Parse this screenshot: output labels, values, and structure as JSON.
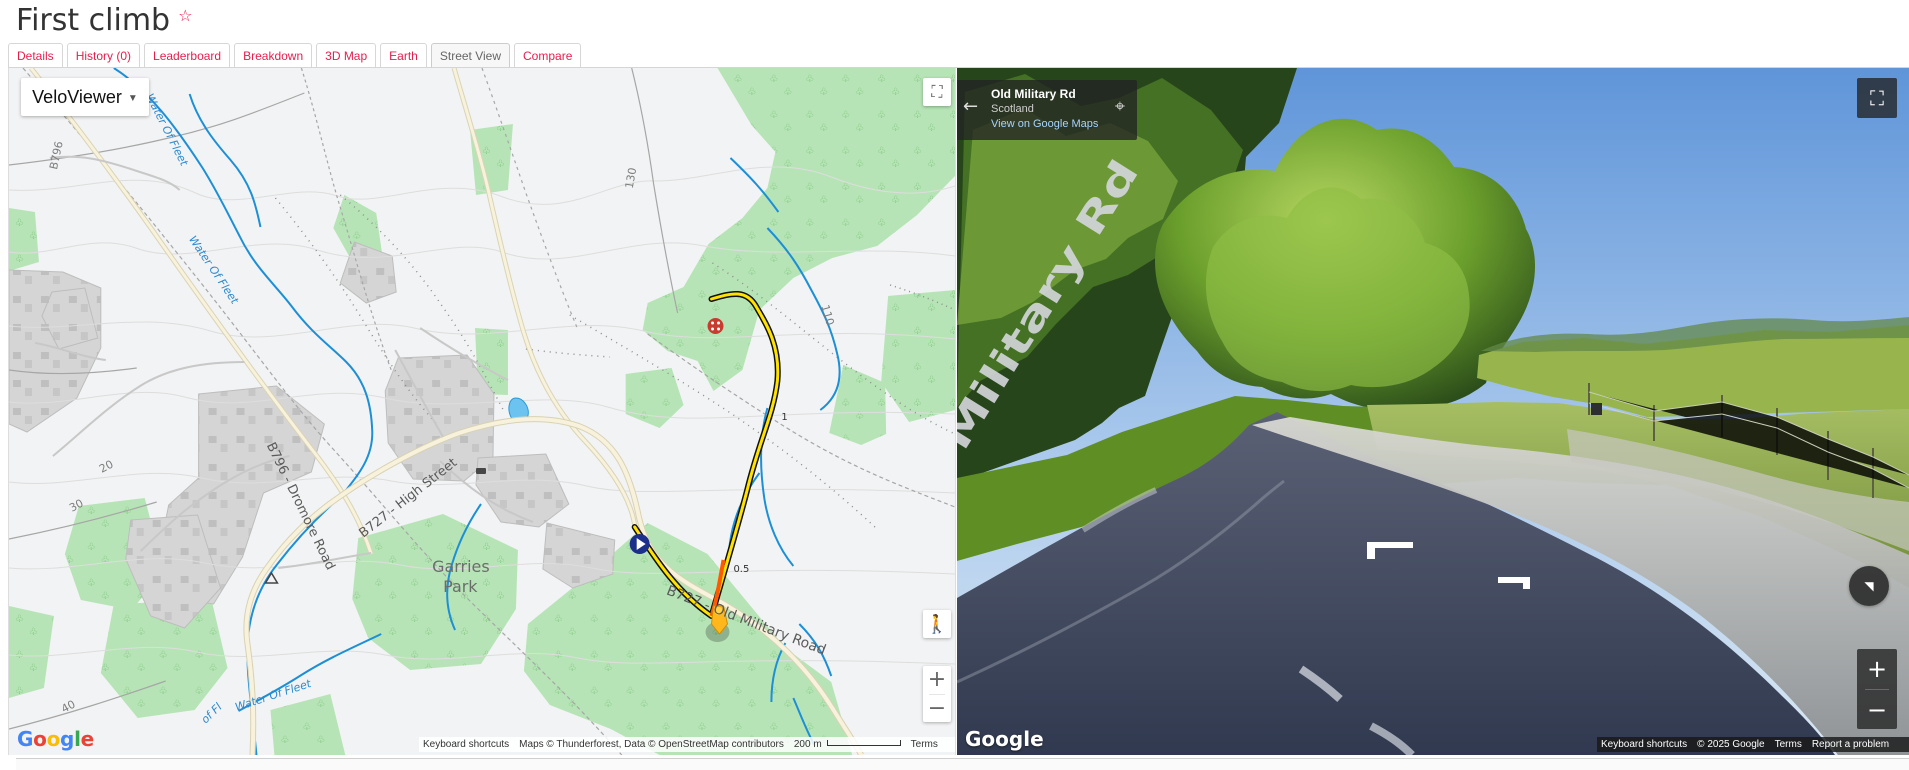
{
  "page": {
    "title": "First climb",
    "title_icon": "star-icon"
  },
  "tabs": [
    {
      "label": "Details"
    },
    {
      "label": "History (0)"
    },
    {
      "label": "Leaderboard"
    },
    {
      "label": "Breakdown"
    },
    {
      "label": "3D Map"
    },
    {
      "label": "Earth"
    },
    {
      "label": "Street View",
      "active": true
    },
    {
      "label": "Compare"
    }
  ],
  "map": {
    "layer_button_label": "VeloViewer",
    "layer_button_icon": "dropdown-caret-icon",
    "fullscreen_icon": "fullscreen-icon",
    "pegman_icon": "pegman-icon",
    "zoom_in_label": "+",
    "zoom_out_label": "−",
    "attribution": {
      "keyboard_shortcuts": "Keyboard shortcuts",
      "data": "Maps © Thunderforest, Data © OpenStreetMap contributors",
      "scale": "200 m",
      "terms": "Terms"
    },
    "logo_text": "Google",
    "labels": {
      "b796": "B796",
      "water_of_fleet_top": "Water Of Fleet",
      "water_of_fleet_mid": "Water Of Fleet",
      "water_of_fleet_bottom": "Water Of Fleet",
      "high_street": "B727 - High Street",
      "dromore_road": "B796 - Dromore Road",
      "garries": "Garries",
      "park": "Park",
      "military_road": "B727 - Old Military Road",
      "contour_130": "130",
      "contour_110": "110",
      "contour_20": "20",
      "contour_30": "30",
      "contour_40": "40",
      "route_mark_1": "1",
      "route_mark_05": "0.5",
      "fleet_bottom_partial": "of Fl"
    }
  },
  "street_view": {
    "road": "Old Military Rd",
    "country": "Scotland",
    "link": "View on Google Maps",
    "back_icon": "back-arrow-icon",
    "pin_icon": "location-pin-icon",
    "fullscreen_icon": "fullscreen-icon",
    "compass_icon": "compass-icon",
    "zoom_in_label": "+",
    "zoom_out_label": "−",
    "attribution": {
      "keyboard_shortcuts": "Keyboard shortcuts",
      "copyright": "© 2025 Google",
      "terms": "Terms",
      "report": "Report a problem"
    },
    "logo_text": "Google",
    "road_painted_text": "Old Military Rd"
  }
}
